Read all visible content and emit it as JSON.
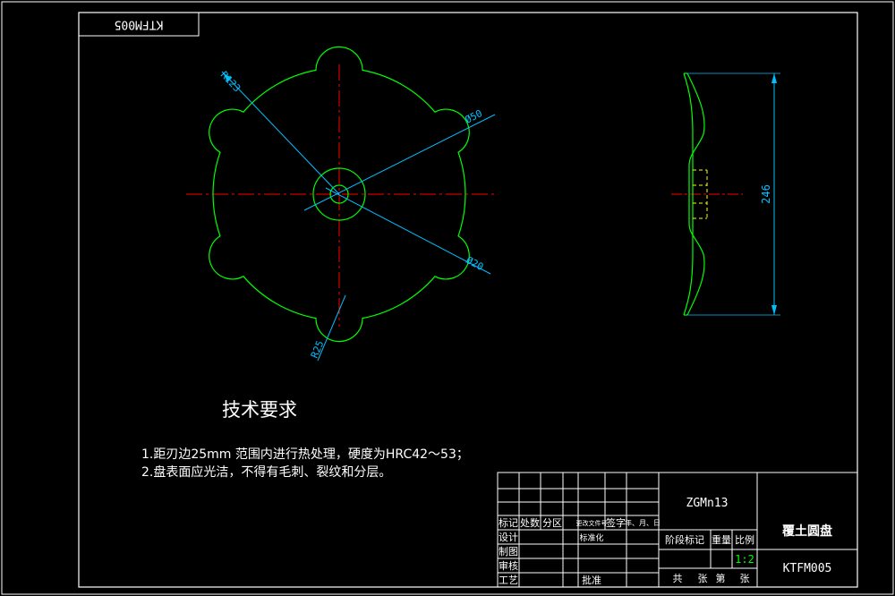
{
  "colors": {
    "background": "#000000",
    "border": "#ffffff",
    "outline": "#00ff00",
    "centerline": "#ff0000",
    "dimension": "#00bfff",
    "hidden_line": "#ffff00",
    "scale_text": "#00ff00"
  },
  "stamp_mirrored": "KTFM005",
  "dimensions": {
    "r_outer": "R123",
    "d_hub": "Ø50",
    "d_hole": "Ø20",
    "r_notch": "R25",
    "overall_height": "246"
  },
  "requirements": {
    "heading": "技术要求",
    "item1": "1.距刃边25mm  范围内进行热处理，硬度为HRC42～53；",
    "item2": "2.盘表面应光洁，不得有毛刺、裂纹和分层。"
  },
  "title_block": {
    "material": "ZGMn13",
    "part_name": "覆土圆盘",
    "drawing_no": "KTFM005",
    "col_headers": [
      "标记",
      "处数",
      "分区",
      "更改文件号",
      "签字",
      "年、月、日"
    ],
    "row_labels": [
      "设计",
      "制图",
      "审核",
      "工艺"
    ],
    "standardization": "标准化",
    "approval": "批准",
    "stage_label": "阶段标记",
    "weight_label": "重量",
    "scale_label": "比例",
    "scale_value": "1:2",
    "sheet_total": "共",
    "sheet_unit": "张",
    "sheet_no": "第",
    "sheet_unit2": "张"
  }
}
